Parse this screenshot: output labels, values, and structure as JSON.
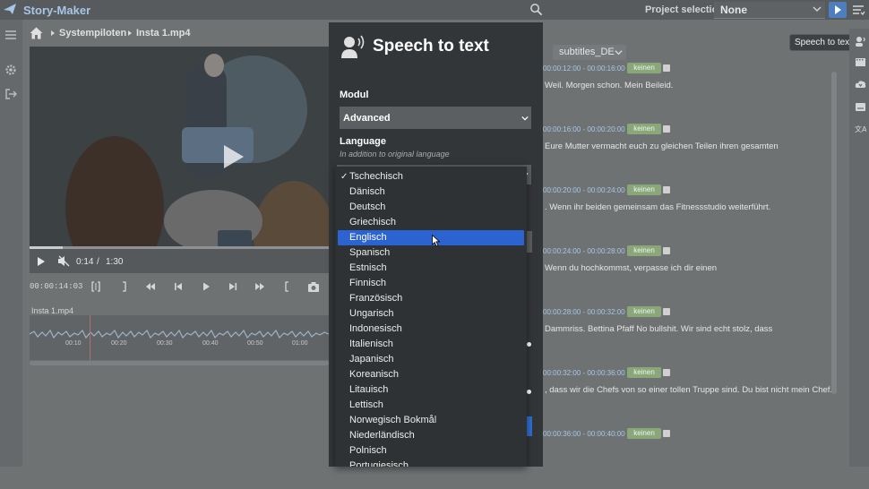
{
  "app": {
    "title": "Story-Maker",
    "project_label": "Project selection:",
    "project_value": "None"
  },
  "breadcrumb": {
    "items": [
      "Systempiloten",
      "Insta 1.mp4"
    ]
  },
  "video": {
    "current_time": "0:14",
    "separator": "/",
    "duration": "1:30",
    "progress": 0.11
  },
  "timecode": "00:00:14:03",
  "timeline": {
    "label": "Insta 1.mp4",
    "ticks": [
      "00:10",
      "00:20",
      "00:30",
      "00:40",
      "00:50",
      "01:00"
    ]
  },
  "subtitles": {
    "language": "subtitles_DE",
    "tooltip": "Speech to text",
    "rows": [
      {
        "tc_start": "00:00:12:00",
        "tc_end": "00:00:16:00",
        "badge": "keinen",
        "text": "Weil. Morgen schon. Mein Beileid."
      },
      {
        "tc_start": "00:00:16:00",
        "tc_end": "00:00:20:00",
        "badge": "keinen",
        "text": "Eure Mutter vermacht euch zu gleichen Teilen ihren gesamten"
      },
      {
        "tc_start": "00:00:20:00",
        "tc_end": "00:00:24:00",
        "badge": "keinen",
        "text": ". Wenn ihr beiden gemeinsam das Fitnessstudio weiterführt."
      },
      {
        "tc_start": "00:00:24:00",
        "tc_end": "00:00:28:00",
        "badge": "keinen",
        "text": "Wenn du hochkommst, verpasse ich dir einen"
      },
      {
        "tc_start": "00:00:28:00",
        "tc_end": "00:00:32:00",
        "badge": "keinen",
        "text": "Dammriss. Bettina Pfaff No bullshit. Wir sind echt stolz, dass"
      },
      {
        "tc_start": "00:00:32:00",
        "tc_end": "00:00:36:00",
        "badge": "keinen",
        "text": ", dass wir die Chefs von so einer tollen Truppe sind. Du bist nicht mein Chef."
      },
      {
        "tc_start": "00:00:36:00",
        "tc_end": "00:00:40:00",
        "badge": "keinen",
        "text": ""
      }
    ],
    "tc_sep": " - "
  },
  "modal": {
    "title": "Speech to text",
    "modul_label": "Modul",
    "modul_value": "Advanced",
    "language_label": "Language",
    "language_hint": "In addition to original language",
    "check_mark": "✓",
    "selected_index": 4,
    "checked_index": 0,
    "languages": [
      "Tschechisch",
      "Dänisch",
      "Deutsch",
      "Griechisch",
      "Englisch",
      "Spanisch",
      "Estnisch",
      "Finnisch",
      "Französisch",
      "Ungarisch",
      "Indonesisch",
      "Italienisch",
      "Japanisch",
      "Koreanisch",
      "Litauisch",
      "Lettisch",
      "Norwegisch Bokmål",
      "Niederländisch",
      "Polnisch",
      "Portugiesisch"
    ]
  },
  "colors": {
    "accent": "#2b63d0",
    "timecode_blue": "#a7c6e6",
    "badge_green": "#8aa77a",
    "overlay": "#6f7273",
    "modal_bg": "#333639"
  }
}
